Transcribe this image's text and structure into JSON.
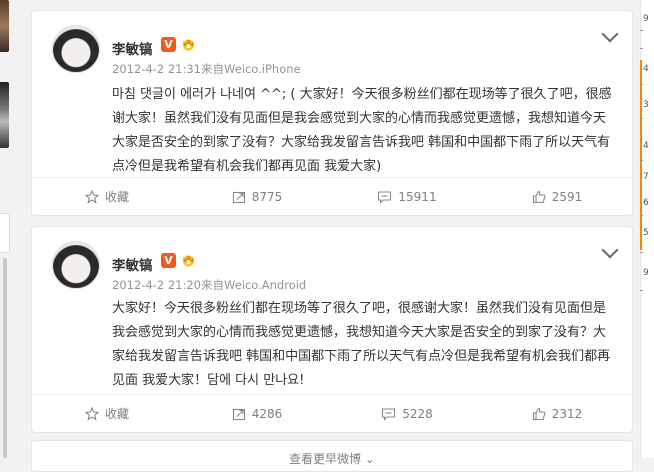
{
  "colors": {
    "accent": "#ff8200",
    "vbadge": "#f05a1a",
    "muted": "#808080"
  },
  "posts": [
    {
      "author": "李敏镐",
      "verified_label": "V",
      "meta": "2012-4-2 21:31来自Weico.iPhone",
      "text": "마침 댓글이 에러가 나네여 ^^; ( 大家好！今天很多粉丝们都在现场等了很久了吧，很感谢大家！虽然我们没有见面但是我会感觉到大家的心情而我感觉更遗憾，我想知道今天大家是否安全的到家了没有？大家给我发留言告诉我吧 韩国和中国都下雨了所以天气有点冷但是我希望有机会我们都再见面 我爱大家)",
      "actions": {
        "favorite": "收藏",
        "repost": "8775",
        "comment": "15911",
        "like": "2591"
      }
    },
    {
      "author": "李敏镐",
      "verified_label": "V",
      "meta": "2012-4-2 21:20来自Weico.Android",
      "text": "大家好！今天很多粉丝们都在现场等了很久了吧，很感谢大家！虽然我们没有见面但是我会感觉到大家的心情而我感觉更遗憾，我想知道今天大家是否安全的到家了没有？大家给我发留言告诉我吧 韩国和中国都下雨了所以天气有点冷但是我希望有机会我们都再见面 我爱大家！담에 다시 만나요!",
      "actions": {
        "favorite": "收藏",
        "repost": "4286",
        "comment": "5228",
        "like": "2312"
      }
    }
  ],
  "more_label": "查看更早微博",
  "timeline_marks": [
    "9",
    "4",
    "3",
    "4",
    "7",
    "6",
    "5",
    "9"
  ]
}
